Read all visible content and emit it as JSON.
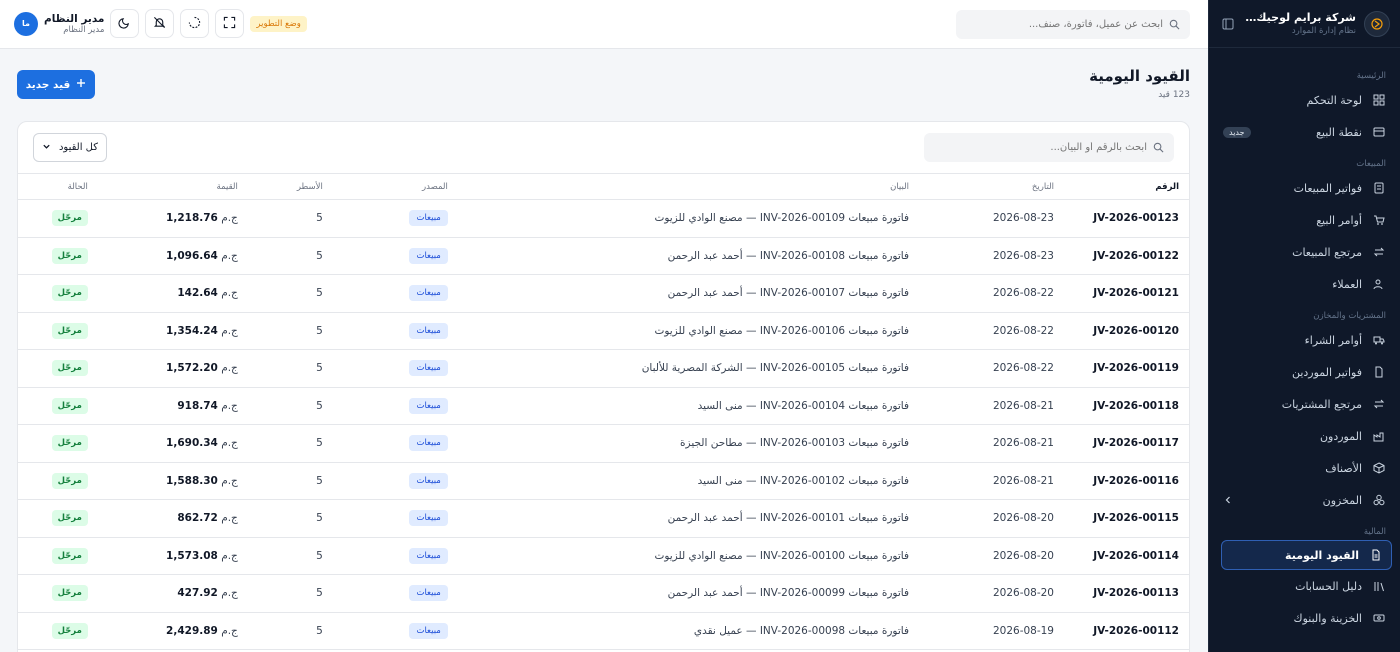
{
  "sidebar": {
    "brand_name": "شركة برايم لوجيك التجر...",
    "brand_sub": "نظام إدارة الموارد",
    "sections": {
      "main": "الرئيسية",
      "sales": "المبيعات",
      "purchases": "المشتريات والمخازن",
      "finance": "المالية"
    },
    "items": {
      "dashboard": "لوحة التحكم",
      "pos": "نقطة البيع",
      "pos_badge": "جديد",
      "sales_invoices": "فواتير المبيعات",
      "sales_orders": "أوامر البيع",
      "sales_returns": "مرتجع المبيعات",
      "customers": "العملاء",
      "purchase_orders": "أوامر الشراء",
      "supplier_invoices": "فواتير الموردين",
      "purchase_returns": "مرتجع المشتريات",
      "suppliers": "الموردون",
      "items": "الأصناف",
      "inventory": "المخزون",
      "journal": "القيود اليومية",
      "chart_accounts": "دليل الحسابات",
      "treasury": "الخزينة والبنوك"
    }
  },
  "topbar": {
    "search_placeholder": "ابحث عن عميل، فاتورة، صنف...",
    "dev_mode": "وضع التطوير",
    "user_name": "مدير النظام",
    "user_role": "مدير النظام",
    "avatar_initials": "ما"
  },
  "page": {
    "title": "القيود اليومية",
    "subtitle": "123 قيد",
    "new_button": "قيد جديد",
    "search_placeholder": "ابحث بالرقم أو البيان...",
    "filter_value": "كل القيود"
  },
  "table": {
    "headers": {
      "number": "الرقم",
      "date": "التاريخ",
      "description": "البيان",
      "source": "المصدر",
      "lines": "الأسطر",
      "value": "القيمة",
      "status": "الحالة"
    },
    "currency": "ج.م",
    "rows": [
      {
        "number": "JV-2026-00123",
        "date": "2026-08-23",
        "description": "فاتورة مبيعات INV-2026-00109 — مصنع الوادي للزيوت",
        "source": "مبيعات",
        "lines": "5",
        "value": "1,218.76",
        "status": "مرحّل"
      },
      {
        "number": "JV-2026-00122",
        "date": "2026-08-23",
        "description": "فاتورة مبيعات INV-2026-00108 — أحمد عبد الرحمن",
        "source": "مبيعات",
        "lines": "5",
        "value": "1,096.64",
        "status": "مرحّل"
      },
      {
        "number": "JV-2026-00121",
        "date": "2026-08-22",
        "description": "فاتورة مبيعات INV-2026-00107 — أحمد عبد الرحمن",
        "source": "مبيعات",
        "lines": "5",
        "value": "142.64",
        "status": "مرحّل"
      },
      {
        "number": "JV-2026-00120",
        "date": "2026-08-22",
        "description": "فاتورة مبيعات INV-2026-00106 — مصنع الوادي للزيوت",
        "source": "مبيعات",
        "lines": "5",
        "value": "1,354.24",
        "status": "مرحّل"
      },
      {
        "number": "JV-2026-00119",
        "date": "2026-08-22",
        "description": "فاتورة مبيعات INV-2026-00105 — الشركة المصرية للألبان",
        "source": "مبيعات",
        "lines": "5",
        "value": "1,572.20",
        "status": "مرحّل"
      },
      {
        "number": "JV-2026-00118",
        "date": "2026-08-21",
        "description": "فاتورة مبيعات INV-2026-00104 — منى السيد",
        "source": "مبيعات",
        "lines": "5",
        "value": "918.74",
        "status": "مرحّل"
      },
      {
        "number": "JV-2026-00117",
        "date": "2026-08-21",
        "description": "فاتورة مبيعات INV-2026-00103 — مطاحن الجيزة",
        "source": "مبيعات",
        "lines": "5",
        "value": "1,690.34",
        "status": "مرحّل"
      },
      {
        "number": "JV-2026-00116",
        "date": "2026-08-21",
        "description": "فاتورة مبيعات INV-2026-00102 — منى السيد",
        "source": "مبيعات",
        "lines": "5",
        "value": "1,588.30",
        "status": "مرحّل"
      },
      {
        "number": "JV-2026-00115",
        "date": "2026-08-20",
        "description": "فاتورة مبيعات INV-2026-00101 — أحمد عبد الرحمن",
        "source": "مبيعات",
        "lines": "5",
        "value": "862.72",
        "status": "مرحّل"
      },
      {
        "number": "JV-2026-00114",
        "date": "2026-08-20",
        "description": "فاتورة مبيعات INV-2026-00100 — مصنع الوادي للزيوت",
        "source": "مبيعات",
        "lines": "5",
        "value": "1,573.08",
        "status": "مرحّل"
      },
      {
        "number": "JV-2026-00113",
        "date": "2026-08-20",
        "description": "فاتورة مبيعات INV-2026-00099 — أحمد عبد الرحمن",
        "source": "مبيعات",
        "lines": "5",
        "value": "427.92",
        "status": "مرحّل"
      },
      {
        "number": "JV-2026-00112",
        "date": "2026-08-19",
        "description": "فاتورة مبيعات INV-2026-00098 — عميل نقدي",
        "source": "مبيعات",
        "lines": "5",
        "value": "2,429.89",
        "status": "مرحّل"
      }
    ]
  },
  "colors": {
    "accent": "#1d6fe0",
    "sidebar_bg": "#0f1829",
    "status_green": "#15803d",
    "dev_orange": "#d97706"
  }
}
